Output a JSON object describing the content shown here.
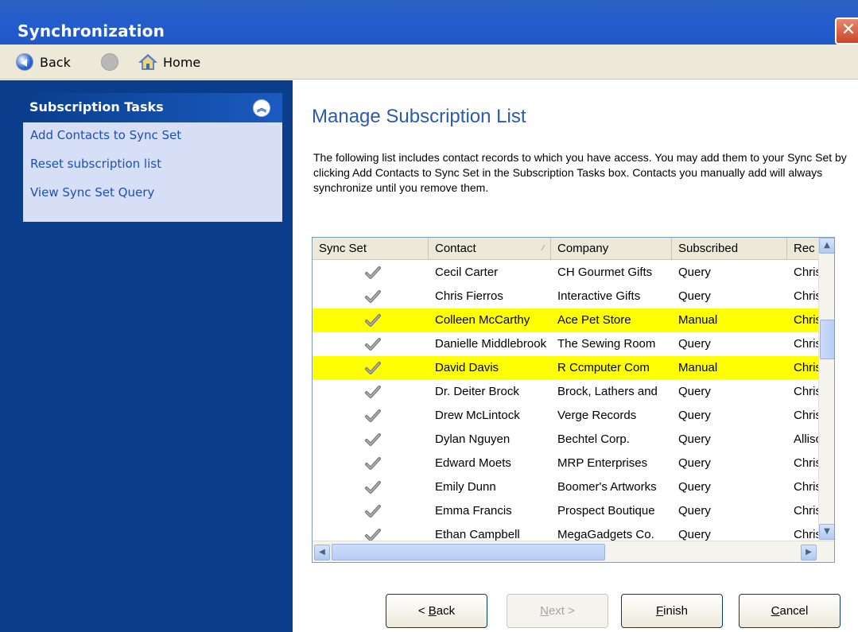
{
  "window": {
    "title": "Synchronization",
    "close_glyph": "✕"
  },
  "nav": {
    "back_label": "Back",
    "home_label": "Home"
  },
  "sidebar": {
    "title": "Subscription Tasks",
    "links": [
      "Add Contacts to Sync Set",
      "Reset subscription list",
      "View Sync Set Query"
    ]
  },
  "main": {
    "title": "Manage Subscription List",
    "description": "The following list includes contact records to which you have access.  You may add them to your Sync Set by clicking Add Contacts to Sync Set in the Subscription Tasks box. Contacts you manually add will always synchronize until you remove them."
  },
  "grid": {
    "columns": [
      "Sync Set",
      "Contact",
      "Company",
      "Subscribed",
      "Rec"
    ],
    "rows": [
      {
        "contact": "Cecil Carter",
        "company": "CH Gourmet Gifts",
        "subscribed": "Query",
        "rec": "Chris",
        "highlight": false
      },
      {
        "contact": "Chris Fierros",
        "company": "Interactive Gifts",
        "subscribed": "Query",
        "rec": "Chris",
        "highlight": false
      },
      {
        "contact": "Colleen McCarthy",
        "company": "Ace Pet Store",
        "subscribed": "Manual",
        "rec": "Chris",
        "highlight": true
      },
      {
        "contact": "Danielle Middlebrook",
        "company": "The Sewing Room",
        "subscribed": "Query",
        "rec": "Chris",
        "highlight": false
      },
      {
        "contact": "David Davis",
        "company": "R Ccmputer Com",
        "subscribed": "Manual",
        "rec": "Chris",
        "highlight": true
      },
      {
        "contact": "Dr. Deiter Brock",
        "company": "Brock, Lathers and",
        "subscribed": "Query",
        "rec": "Chris",
        "highlight": false
      },
      {
        "contact": "Drew McLintock",
        "company": "Verge Records",
        "subscribed": "Query",
        "rec": "Chris",
        "highlight": false
      },
      {
        "contact": "Dylan Nguyen",
        "company": "Bechtel Corp.",
        "subscribed": "Query",
        "rec": "Allison",
        "highlight": false
      },
      {
        "contact": "Edward Moets",
        "company": "MRP Enterprises",
        "subscribed": "Query",
        "rec": "Chris",
        "highlight": false
      },
      {
        "contact": "Emily Dunn",
        "company": "Boomer's Artworks",
        "subscribed": "Query",
        "rec": "Chris",
        "highlight": false
      },
      {
        "contact": "Emma Francis",
        "company": "Prospect Boutique",
        "subscribed": "Query",
        "rec": "Chris",
        "highlight": false
      },
      {
        "contact": "Ethan Campbell",
        "company": "MegaGadgets Co.",
        "subscribed": "Query",
        "rec": "Chris",
        "highlight": false
      }
    ]
  },
  "buttons": {
    "back": {
      "pre": "< ",
      "key": "B",
      "post": "ack"
    },
    "next": {
      "pre": "",
      "key": "N",
      "post": "ext >"
    },
    "finish": {
      "pre": "",
      "key": "F",
      "post": "inish"
    },
    "cancel": {
      "pre": "",
      "key": "C",
      "post": "ancel"
    }
  },
  "colors": {
    "title_bar": "#245ccd",
    "sidebar": "#0a3e8c",
    "highlight_row": "#ffff00",
    "link": "#1c4fb8",
    "heading": "#2a5ab0"
  }
}
